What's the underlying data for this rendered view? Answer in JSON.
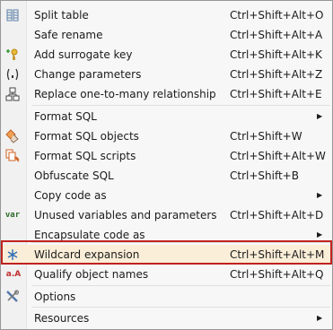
{
  "menu": {
    "items": [
      {
        "label": "Split table",
        "shortcut": "Ctrl+Shift+Alt+O",
        "icon": "split-table-icon"
      },
      {
        "label": "Safe rename",
        "shortcut": "Ctrl+Shift+Alt+A",
        "icon": ""
      },
      {
        "label": "Add surrogate key",
        "shortcut": "Ctrl+Shift+Alt+K",
        "icon": "key-plus-icon"
      },
      {
        "label": "Change parameters",
        "shortcut": "Ctrl+Shift+Alt+Z",
        "icon": "parameters-icon"
      },
      {
        "label": "Replace one-to-many relationship",
        "shortcut": "Ctrl+Shift+Alt+E",
        "icon": "relationship-icon"
      },
      {
        "label": "Format SQL",
        "shortcut": "",
        "submenu": true,
        "icon": ""
      },
      {
        "label": "Format SQL objects",
        "shortcut": "Ctrl+Shift+W",
        "icon": "format-objects-icon"
      },
      {
        "label": "Format SQL scripts",
        "shortcut": "Ctrl+Shift+Alt+W",
        "icon": "format-scripts-icon"
      },
      {
        "label": "Obfuscate SQL",
        "shortcut": "Ctrl+Shift+B",
        "icon": ""
      },
      {
        "label": "Copy code as",
        "shortcut": "",
        "submenu": true,
        "icon": ""
      },
      {
        "label": "Unused variables and parameters",
        "shortcut": "Ctrl+Shift+Alt+D",
        "icon": "var-icon"
      },
      {
        "label": "Encapsulate code as",
        "shortcut": "",
        "submenu": true,
        "icon": ""
      },
      {
        "label": "Wildcard expansion",
        "shortcut": "Ctrl+Shift+Alt+M",
        "icon": "wildcard-icon",
        "highlighted": true
      },
      {
        "label": "Qualify object names",
        "shortcut": "Ctrl+Shift+Alt+Q",
        "icon": "qualify-icon"
      },
      {
        "label": "Options",
        "shortcut": "",
        "icon": "tools-icon"
      },
      {
        "label": "Resources",
        "shortcut": "",
        "submenu": true,
        "icon": ""
      }
    ],
    "var_glyph": "var",
    "qualify_glyph": "a.A",
    "submenu_arrow": "▶",
    "highlight_color": "#c0221f"
  }
}
